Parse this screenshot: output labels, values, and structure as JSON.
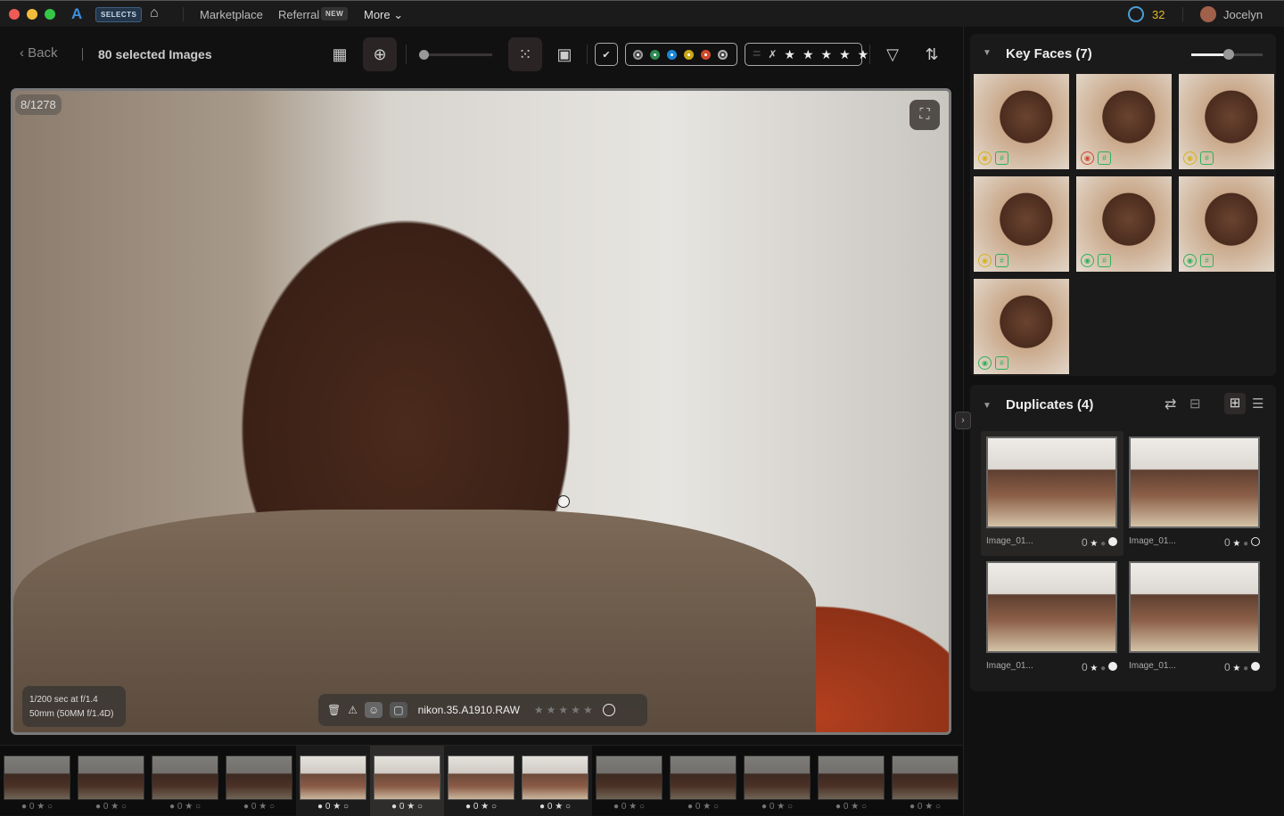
{
  "topbar": {
    "app_badge": "SELECTS",
    "nav": [
      "Marketplace",
      "Referral",
      "More"
    ],
    "referral_badge": "NEW",
    "credits": "32",
    "user": "Jocelyn"
  },
  "toolbar": {
    "back": "Back",
    "selection": "80 selected Images",
    "zoom_slider": 0.0,
    "color_labels": [
      "#9a9a9a",
      "#2f8a56",
      "#1b86d6",
      "#c9a81a",
      "#d04a2e",
      "#b0b0b0"
    ],
    "star_count": 5
  },
  "viewer": {
    "counter": "8/1278",
    "exposure": "1/200 sec at f/1.4",
    "lens": "50mm (50MM f/1.4D)",
    "filename": "nikon.35.A1910.RAW",
    "rating": 0
  },
  "key_faces": {
    "title": "Key Faces (7)",
    "size_slider": 0.6,
    "faces": [
      {
        "eye": "#d6b21a",
        "tag": "#2fb05a"
      },
      {
        "eye": "#d04a2e",
        "tag": "#2fb05a"
      },
      {
        "eye": "#d6b21a",
        "tag": "#2fb05a"
      },
      {
        "eye": "#d6b21a",
        "tag": "#2fb05a"
      },
      {
        "eye": "#2fb05a",
        "tag": "#2fb05a"
      },
      {
        "eye": "#2fb05a",
        "tag": "#2fb05a"
      },
      {
        "eye": "#2fb05a",
        "tag": "#2fb05a"
      }
    ]
  },
  "duplicates": {
    "title": "Duplicates (4)",
    "items": [
      {
        "name": "Image_01...",
        "rating": "0",
        "picked": true
      },
      {
        "name": "Image_01...",
        "rating": "0",
        "picked": false
      },
      {
        "name": "Image_01...",
        "rating": "0",
        "picked": true
      },
      {
        "name": "Image_01...",
        "rating": "0",
        "picked": true
      }
    ]
  },
  "filmstrip": {
    "items": [
      {
        "rating": "0"
      },
      {
        "rating": "0"
      },
      {
        "rating": "0"
      },
      {
        "rating": "0"
      },
      {
        "rating": "0"
      },
      {
        "rating": "0"
      },
      {
        "rating": "0"
      },
      {
        "rating": "0"
      },
      {
        "rating": "0"
      },
      {
        "rating": "0"
      },
      {
        "rating": "0"
      },
      {
        "rating": "0"
      },
      {
        "rating": "0"
      }
    ],
    "group_range": [
      5,
      8
    ],
    "selected": 6
  }
}
